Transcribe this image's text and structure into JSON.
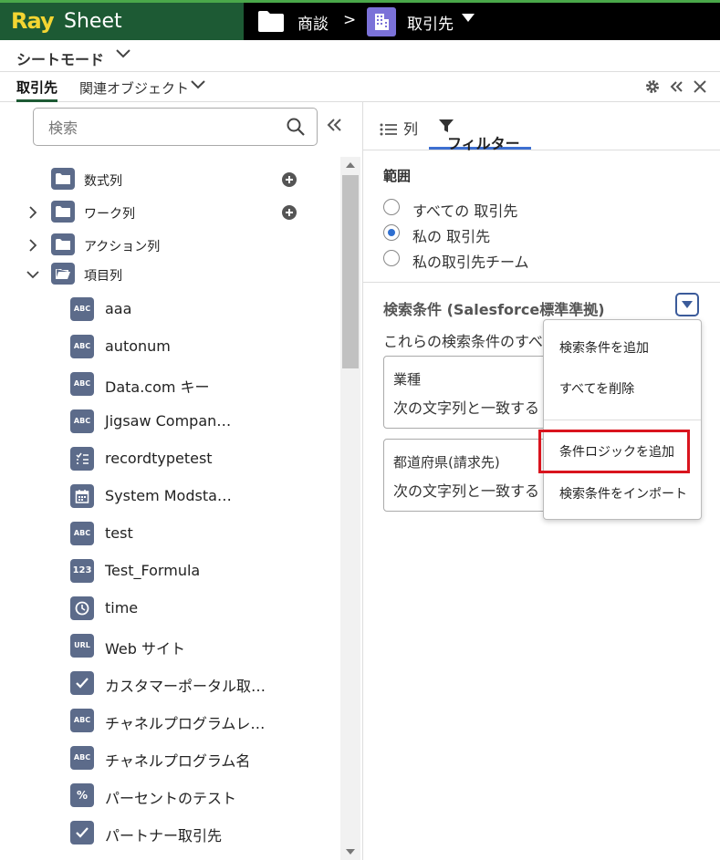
{
  "app": {
    "logo_ray": "Ray",
    "logo_sheet": "Sheet"
  },
  "breadcrumb": {
    "parent": "商談",
    "separator": ">",
    "current": "取引先"
  },
  "mode": {
    "label": "シートモード"
  },
  "tabs": {
    "active": "取引先",
    "related": "関連オブジェクト"
  },
  "search": {
    "placeholder": "検索"
  },
  "tree": {
    "folders": [
      {
        "label": "数式列",
        "expanded": false,
        "has_arrow": false,
        "has_plus": true
      },
      {
        "label": "ワーク列",
        "expanded": false,
        "has_arrow": true,
        "has_plus": true
      },
      {
        "label": "アクション列",
        "expanded": false,
        "has_arrow": true,
        "has_plus": false
      },
      {
        "label": "項目列",
        "expanded": true,
        "has_arrow": true,
        "has_plus": false
      }
    ],
    "fields": [
      {
        "type": "ABC",
        "icon": "text-field-icon",
        "label": "aaa"
      },
      {
        "type": "ABC",
        "icon": "text-field-icon",
        "label": "autonum"
      },
      {
        "type": "ABC",
        "icon": "text-field-icon",
        "label": "Data.com キー"
      },
      {
        "type": "ABC",
        "icon": "text-field-icon",
        "label": "Jigsaw Compan…"
      },
      {
        "type": "",
        "icon": "picklist-icon",
        "label": "recordtypetest"
      },
      {
        "type": "",
        "icon": "calendar-icon",
        "label": "System Modsta…"
      },
      {
        "type": "ABC",
        "icon": "text-field-icon",
        "label": "test"
      },
      {
        "type": "123",
        "icon": "number-field-icon",
        "label": "Test_Formula"
      },
      {
        "type": "",
        "icon": "clock-icon",
        "label": "time"
      },
      {
        "type": "URL",
        "icon": "url-field-icon",
        "label": "Web サイト"
      },
      {
        "type": "",
        "icon": "checkbox-icon",
        "label": "カスタマーポータル取…"
      },
      {
        "type": "ABC",
        "icon": "text-field-icon",
        "label": "チャネルプログラムレ…"
      },
      {
        "type": "ABC",
        "icon": "text-field-icon",
        "label": "チャネルプログラム名"
      },
      {
        "type": "%",
        "icon": "percent-field-icon",
        "label": "パーセントのテスト"
      },
      {
        "type": "",
        "icon": "checkbox-icon",
        "label": "パートナー取引先"
      }
    ]
  },
  "right_tabs": {
    "columns": "列",
    "filter": "フィルター"
  },
  "scope": {
    "title": "範囲",
    "options": [
      {
        "label": "すべての 取引先",
        "selected": false
      },
      {
        "label": "私の 取引先",
        "selected": true
      },
      {
        "label": "私の取引先チーム",
        "selected": false
      }
    ]
  },
  "criteria": {
    "title": "検索条件 (Salesforce標準準拠)",
    "description": "これらの検索条件のすべて",
    "cards": [
      {
        "field": "業種",
        "operator": "次の文字列と一致する"
      },
      {
        "field": "都道府県(請求先)",
        "operator": "次の文字列と一致する"
      }
    ]
  },
  "menu": {
    "items": [
      "検索条件を追加",
      "すべてを削除",
      "条件ロジックを追加",
      "検索条件をインポート"
    ],
    "highlighted_index": 2
  },
  "colors": {
    "logo_bg": "#1d5a34",
    "logo_ray": "#f3d532",
    "accent_blue": "#3d6fd1",
    "icon_slate": "#5c6b8a",
    "highlight_red": "#d9141e"
  }
}
